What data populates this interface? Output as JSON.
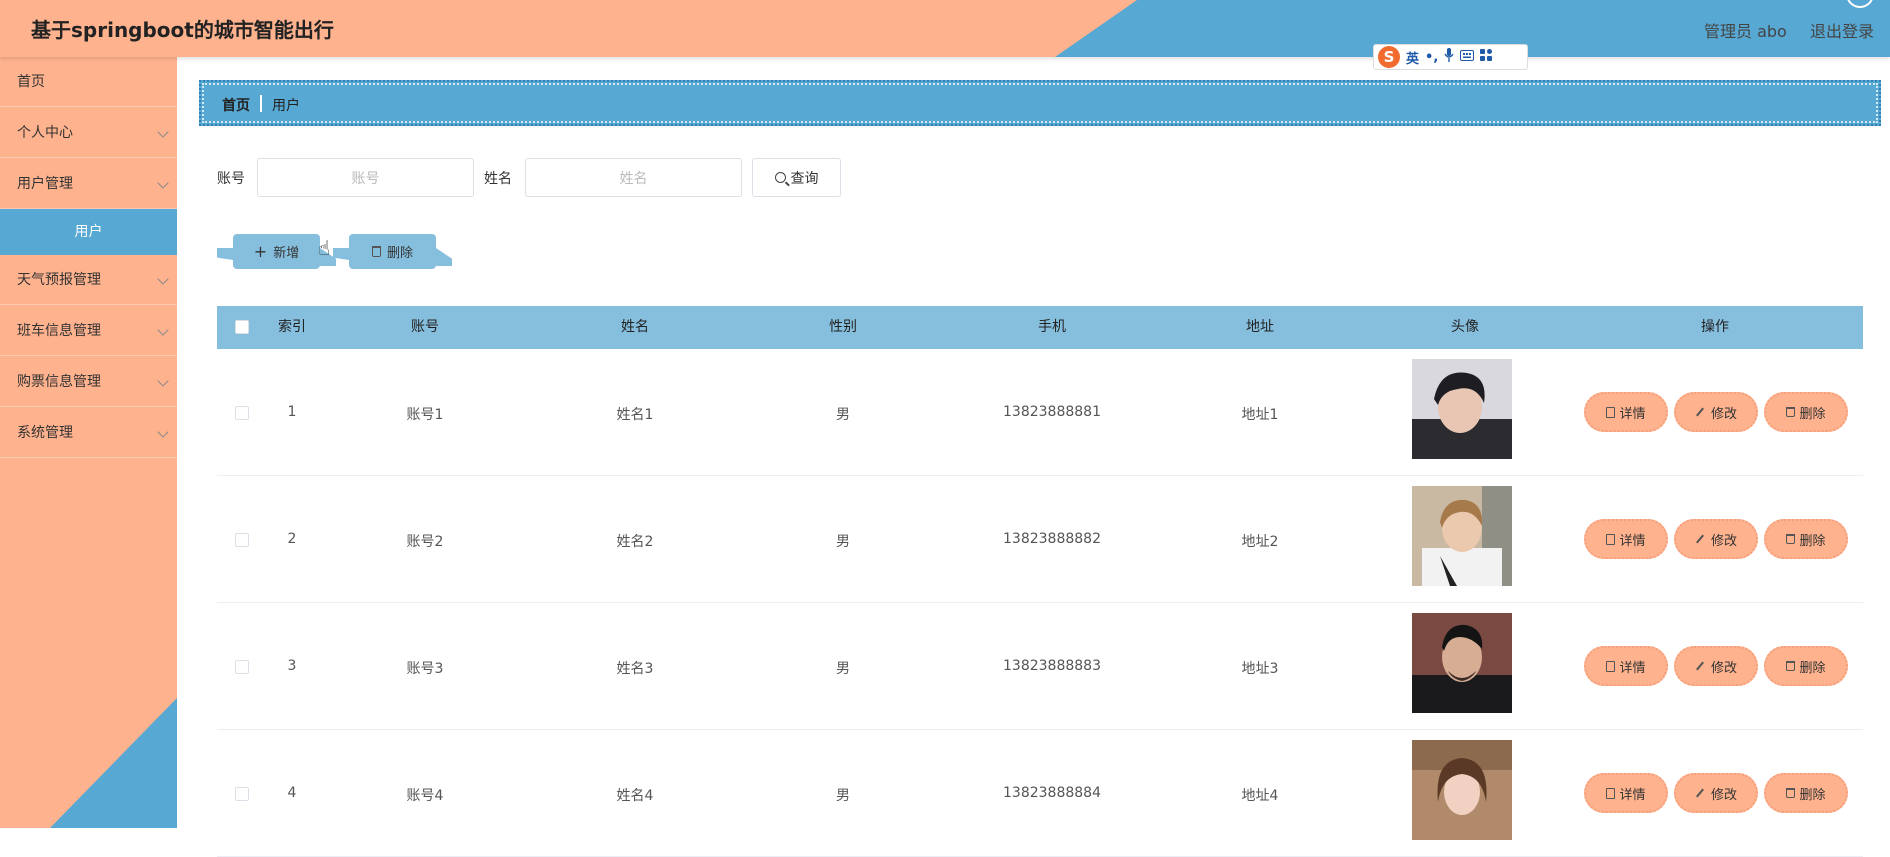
{
  "header": {
    "title": "基于springboot的城市智能出行",
    "admin_label": "管理员 abo",
    "logout": "退出登录"
  },
  "ime": {
    "logo": "S",
    "lang": "英",
    "punct": "•,",
    "icons": [
      "mic-icon",
      "keyboard-icon",
      "grid-icon"
    ]
  },
  "sidebar": {
    "items": [
      {
        "label": "首页"
      },
      {
        "label": "个人中心"
      },
      {
        "label": "用户管理"
      },
      {
        "label": "天气预报管理"
      },
      {
        "label": "班车信息管理"
      },
      {
        "label": "购票信息管理"
      },
      {
        "label": "系统管理"
      }
    ],
    "sub_active": "用户"
  },
  "breadcrumb": {
    "home": "首页",
    "current": "用户"
  },
  "search": {
    "account_label": "账号",
    "account_placeholder": "账号",
    "name_label": "姓名",
    "name_placeholder": "姓名",
    "search_btn": "查询"
  },
  "actions": {
    "add": "新增",
    "delete": "删除"
  },
  "table": {
    "columns": [
      "索引",
      "账号",
      "姓名",
      "性别",
      "手机",
      "地址",
      "头像",
      "操作"
    ],
    "rows": [
      {
        "index": "1",
        "account": "账号1",
        "name": "姓名1",
        "gender": "男",
        "phone": "13823888881",
        "address": "地址1"
      },
      {
        "index": "2",
        "account": "账号2",
        "name": "姓名2",
        "gender": "男",
        "phone": "13823888882",
        "address": "地址2"
      },
      {
        "index": "3",
        "account": "账号3",
        "name": "姓名3",
        "gender": "男",
        "phone": "13823888883",
        "address": "地址3"
      },
      {
        "index": "4",
        "account": "账号4",
        "name": "姓名4",
        "gender": "男",
        "phone": "13823888884",
        "address": "地址4"
      }
    ],
    "op_labels": {
      "detail": "详情",
      "edit": "修改",
      "delete": "删除"
    }
  },
  "colors": {
    "peach": "#ffb28e",
    "blue": "#58a8d4",
    "light_blue": "#86bfde"
  }
}
